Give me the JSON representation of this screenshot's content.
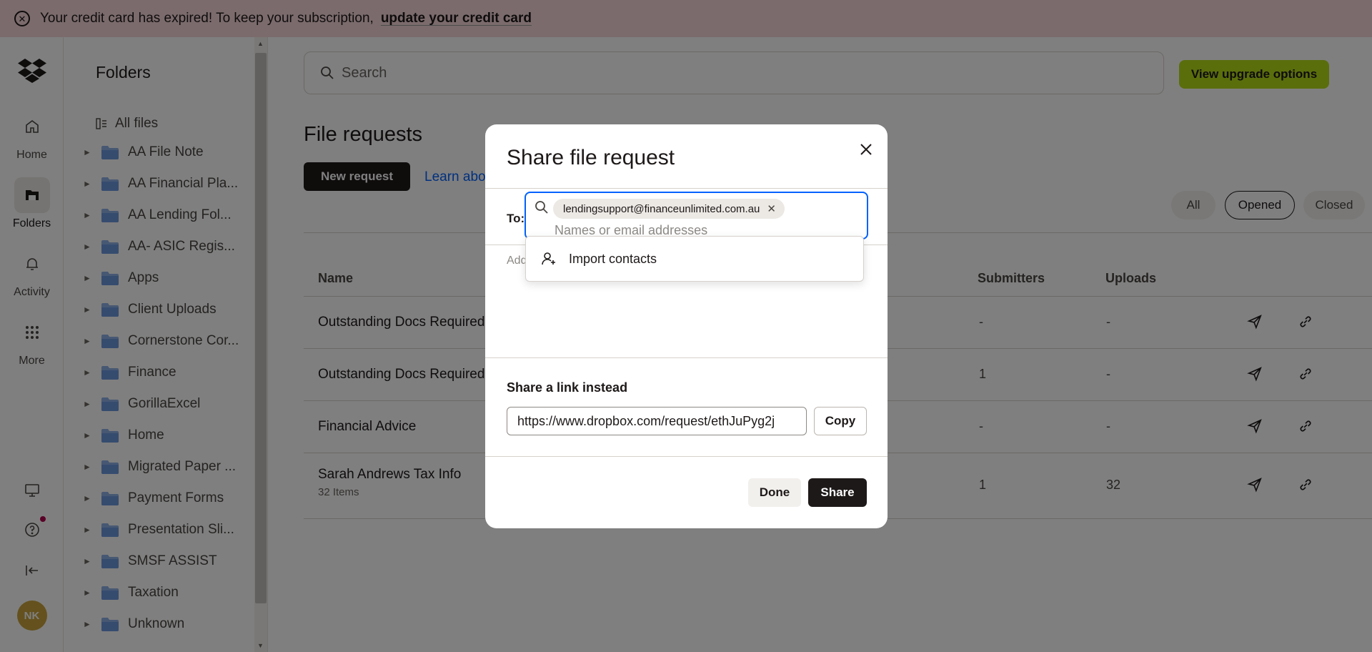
{
  "banner": {
    "message": "Your credit card has expired! To keep your subscription,",
    "link": "update your credit card"
  },
  "rail": {
    "items": [
      {
        "label": "Home",
        "icon": "home-icon"
      },
      {
        "label": "Folders",
        "icon": "folders-icon",
        "active": true
      },
      {
        "label": "Activity",
        "icon": "bell-icon"
      },
      {
        "label": "More",
        "icon": "grid-icon"
      }
    ],
    "avatar": "NK"
  },
  "sidebar": {
    "title": "Folders",
    "all_files": "All files",
    "folders": [
      "AA File Note",
      "AA Financial Pla...",
      "AA Lending Fol...",
      "AA- ASIC Regis...",
      "Apps",
      "Client Uploads",
      "Cornerstone Cor...",
      "Finance",
      "GorillaExcel",
      "Home",
      "Migrated Paper ...",
      "Payment Forms",
      "Presentation Sli...",
      "SMSF ASSIST",
      "Taxation",
      "Unknown"
    ]
  },
  "main": {
    "search_placeholder": "Search",
    "upgrade": "View upgrade options",
    "title": "File requests",
    "new_request": "New request",
    "learn_more": "Learn abo",
    "filters": [
      "All",
      "Opened",
      "Closed"
    ],
    "columns": {
      "name": "Name",
      "submitters": "Submitters",
      "uploads": "Uploads"
    },
    "rows": [
      {
        "name": "Outstanding Docs Required",
        "sub": "",
        "submitters": "-",
        "uploads": "-"
      },
      {
        "name": "Outstanding Docs Required",
        "sub": "",
        "submitters": "1",
        "uploads": "-"
      },
      {
        "name": "Financial Advice",
        "sub": "",
        "submitters": "-",
        "uploads": "-"
      },
      {
        "name": "Sarah Andrews Tax Info",
        "sub": "32 Items",
        "submitters": "1",
        "uploads": "32"
      }
    ]
  },
  "modal": {
    "title": "Share file request",
    "to_label": "To:",
    "chip": "lendingsupport@financeunlimited.com.au",
    "to_placeholder": "Names or email addresses",
    "message_placeholder": "Add",
    "dropdown_item": "Import contacts",
    "share_link_label": "Share a link instead",
    "link": "https://www.dropbox.com/request/ethJuPyg2j",
    "copy": "Copy",
    "done": "Done",
    "share": "Share"
  }
}
